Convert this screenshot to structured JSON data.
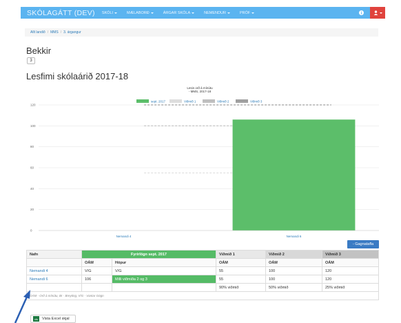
{
  "navbar": {
    "brand": "SKÓLAGÁTT (DEV)",
    "items": [
      {
        "label": "SKÓLI"
      },
      {
        "label": "MÆLABORÐ"
      },
      {
        "label": "ÁRGAR SKÓLA"
      },
      {
        "label": "NEMENDUR"
      },
      {
        "label": "PRÓF"
      }
    ]
  },
  "breadcrumb": {
    "items": [
      "Allt landið",
      "MMS",
      "3. árgangur"
    ]
  },
  "page": {
    "section_title": "Bekkir",
    "class_value": "3",
    "chart_heading": "Lesfimi skólaárið 2017-18"
  },
  "chart_data": {
    "type": "bar",
    "title": "Lesin orð á mínútu",
    "subtitle": "- MMS, 2017-18",
    "categories": [
      "Nemandi 4",
      "Nemandi 6"
    ],
    "series": [
      {
        "name": "sept. 2017",
        "values": [
          0,
          106
        ]
      }
    ],
    "benchmarks": [
      {
        "name": "Viðmið 1",
        "value": 55
      },
      {
        "name": "Viðmið 2",
        "value": 100
      },
      {
        "name": "Viðmið 3",
        "value": 120
      }
    ],
    "yticks": [
      0,
      20,
      40,
      60,
      80,
      100,
      120
    ],
    "ylim": [
      0,
      120
    ],
    "grid": true,
    "legend_position": "top-center",
    "colors": {
      "bar": "#5cbe6a",
      "benchmark1": "#dddddd",
      "benchmark2": "#bfbfbf",
      "benchmark3": "#a0a0a0"
    }
  },
  "buttons": {
    "data_toggle": "- Gagnatafla",
    "excel": "Vista Excel skjal",
    "excel_icon": "xlsx-icon"
  },
  "table": {
    "headers": [
      "Nafn",
      "Fyrirlögn sept. 2017",
      "Viðmið 1",
      "Viðmið 2",
      "Viðmið 3"
    ],
    "subheaders": [
      "",
      "OÁM",
      "Hópur",
      "OÁM",
      "OÁM",
      "OÁM"
    ],
    "rows": [
      {
        "name": "Nemandi 4",
        "oam": "V/G",
        "group": "V/G",
        "v1": "55",
        "v2": "100",
        "v3": "120"
      },
      {
        "name": "Nemandi 6",
        "oam": "106",
        "group": "Milli viðmiða 2 og 3",
        "v1": "55",
        "v2": "100",
        "v3": "120"
      }
    ],
    "percent_row": [
      "",
      "",
      "",
      "90% viðmið",
      "50% viðmið",
      "25% viðmið"
    ],
    "legend": "OÁM - Orð á mínútu, Br - Breyting, V/G - Vantar Gögn"
  }
}
